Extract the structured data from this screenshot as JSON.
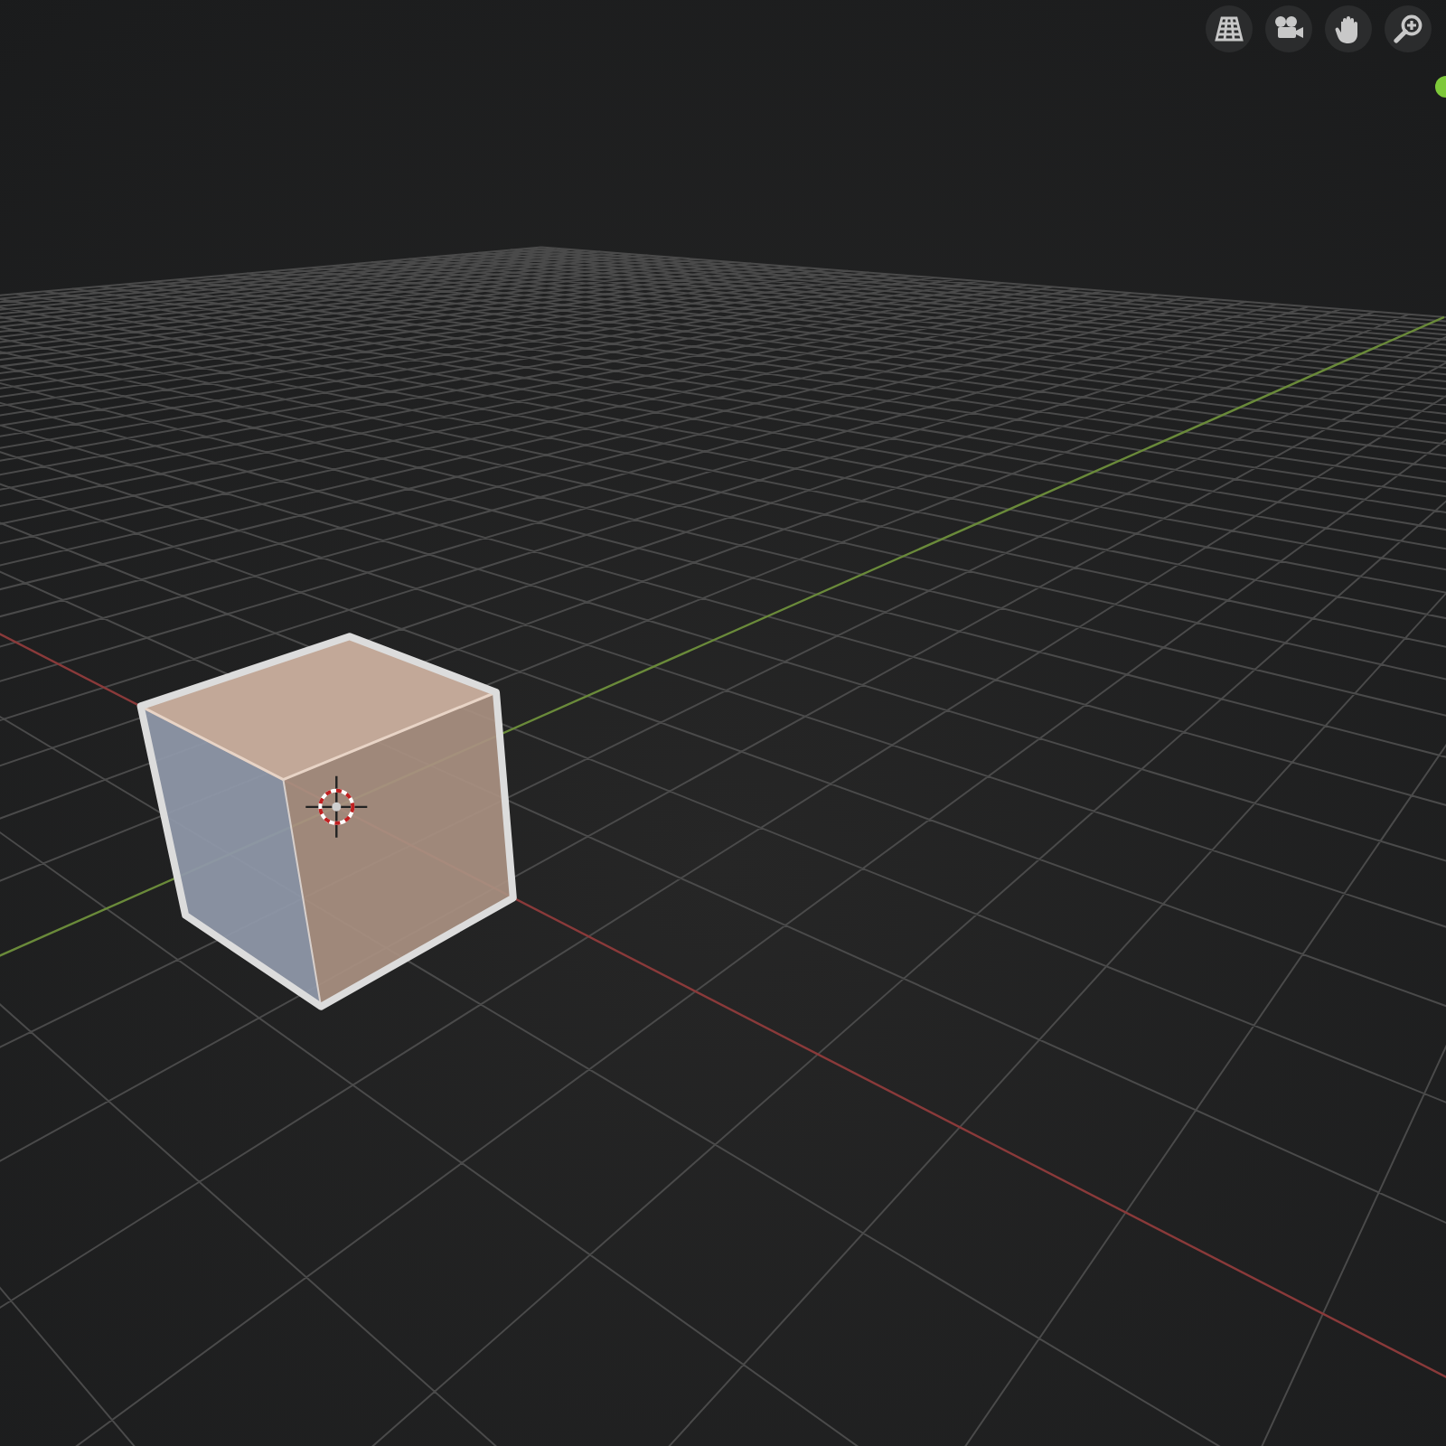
{
  "viewport": {
    "navigation_buttons": [
      {
        "kind": "grid"
      },
      {
        "kind": "camera"
      },
      {
        "kind": "hand"
      },
      {
        "kind": "zoom"
      }
    ],
    "status_dot": {
      "color": "#7ec93a"
    }
  }
}
